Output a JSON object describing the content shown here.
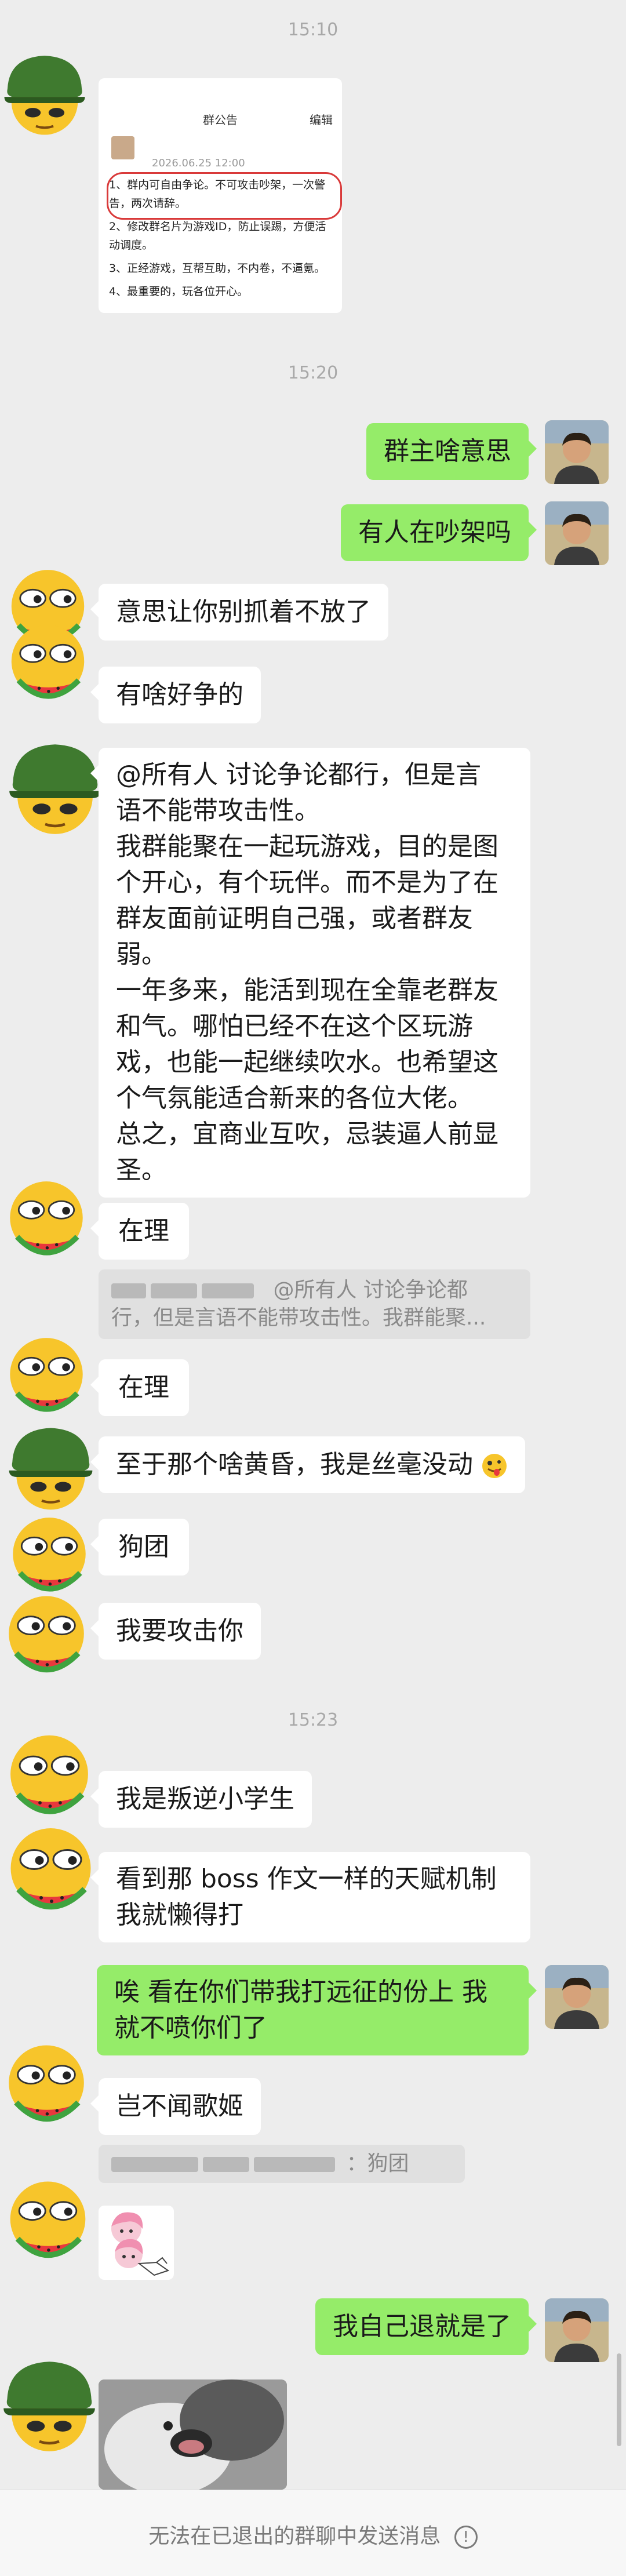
{
  "timestamps": [
    "15:10",
    "15:20",
    "15:23"
  ],
  "notice": {
    "title": "群公告",
    "edit": "编辑",
    "date": "2026.06.25 12:00",
    "lines": [
      "1、群内可自由争论。不可攻击吵架，一次警告，两次请辞。",
      "2、修改群名片为游戏ID，防止误踢，方便活动调度。",
      "3、正经游戏，互帮互助，不内卷，不逼氪。",
      "4、最重要的，玩各位开心。"
    ]
  },
  "messages": {
    "m1": "群主啥意思",
    "m2": "有人在吵架吗",
    "m3": "意思让你别抓着不放了",
    "m4": "有啥好争的",
    "m5_lines": [
      "@所有人  讨论争论都行，但是言",
      "语不能带攻击性。",
      "我群能聚在一起玩游戏，目的是图",
      "个开心，有个玩伴。而不是为了在",
      "群友面前证明自己强，或者群友",
      "弱。",
      "一年多来，能活到现在全靠老群友",
      "和气。哪怕已经不在这个区玩游",
      "戏，也能一起继续吹水。也希望这",
      "个气氛能适合新来的各位大佬。",
      "总之，宜商业互吹，忌装逼人前显",
      "圣。"
    ],
    "m6": "在理",
    "quote1_line1": "@所有人 讨论争论都",
    "quote1_line2": "行，但是言语不能带攻击性。我群能聚...",
    "m7": "在理",
    "m8": "至于那个啥黄昏，我是丝毫没动",
    "m9": "狗团",
    "m10": "我要攻击你",
    "m11": "我是叛逆小学生",
    "m12_lines": [
      "看到那 boss 作文一样的天赋机制",
      "我就懒得打"
    ],
    "m13_lines": [
      "唉 看在你们带我打远征的份上 我",
      "就不喷你们了"
    ],
    "m14": "岂不闻歌姬",
    "quote2_text": "：狗团",
    "m15": "我自己退就是了"
  },
  "footer": {
    "notice": "无法在已退出的群聊中发送消息",
    "info_icon": "info-icon"
  },
  "colors": {
    "background": "#ededed",
    "outgoing": "#95ec69",
    "incoming": "#ffffff",
    "timestamp": "#a8a8a8"
  }
}
